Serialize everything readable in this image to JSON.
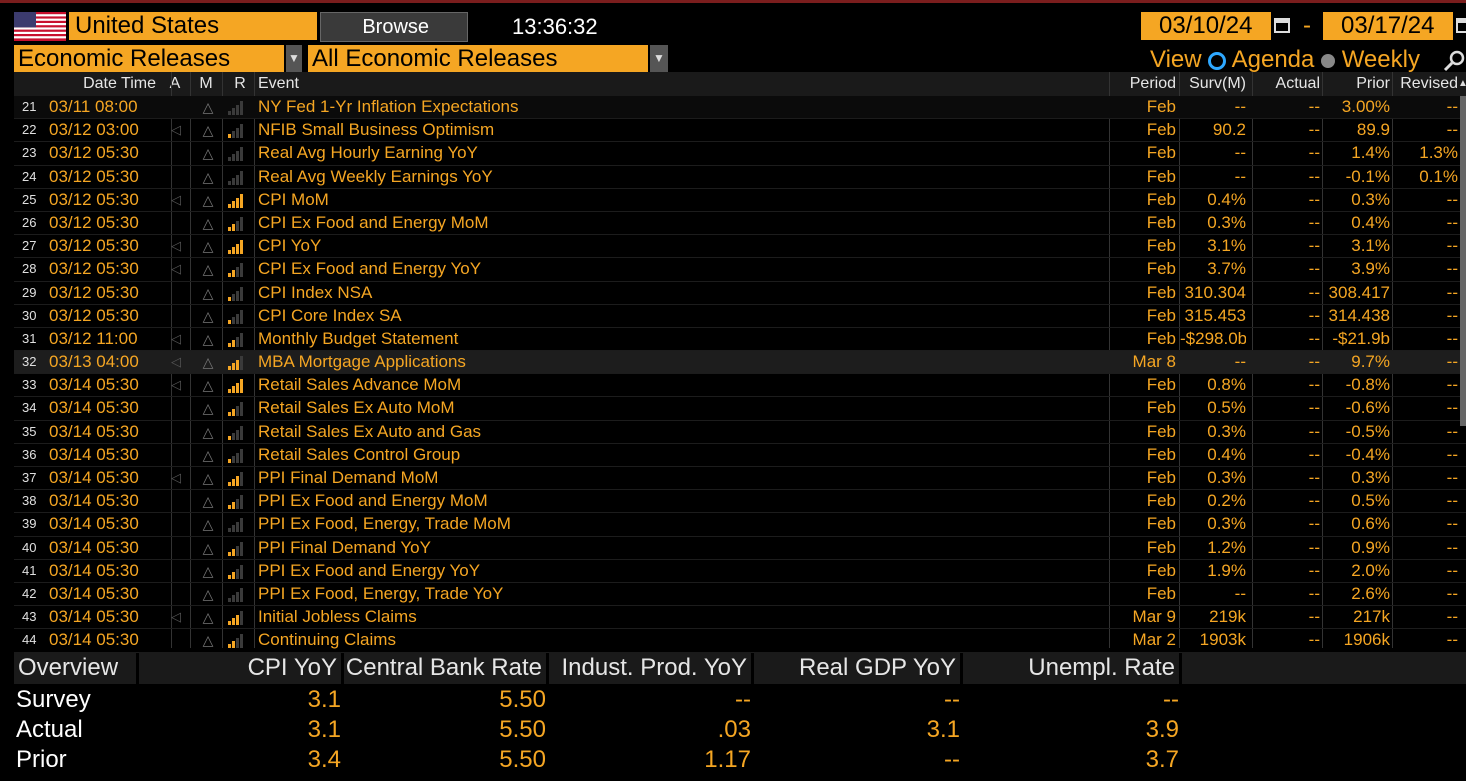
{
  "top": {
    "country": "United States",
    "browse_label": " Browse",
    "time": "13:36:32",
    "date_from": "03/10/24",
    "date_sep": "-",
    "date_to": "03/17/24",
    "category": "Economic Releases",
    "filter": "All Economic Releases",
    "view_label": "View",
    "view_agenda": "Agenda",
    "view_weekly": "Weekly"
  },
  "table": {
    "headers": {
      "datetime": "Date Time",
      "a": "A",
      "m": "M",
      "r": "R",
      "event": "Event",
      "period": "Period",
      "survey": "Surv(M)",
      "actual": "Actual",
      "prior": "Prior",
      "revised": "Revised"
    },
    "rows": [
      {
        "idx": "21",
        "dt": "03/11 08:00",
        "a": false,
        "r": 0,
        "event": "NY Fed 1-Yr Inflation Expectations",
        "period": "Feb",
        "surv": "--",
        "actual": "--",
        "prior": "3.00%",
        "revised": "--"
      },
      {
        "idx": "22",
        "dt": "03/12 03:00",
        "a": true,
        "r": 1,
        "event": "NFIB Small Business Optimism",
        "period": "Feb",
        "surv": "90.2",
        "actual": "--",
        "prior": "89.9",
        "revised": "--"
      },
      {
        "idx": "23",
        "dt": "03/12 05:30",
        "a": false,
        "r": 0,
        "event": "Real Avg Hourly Earning YoY",
        "period": "Feb",
        "surv": "--",
        "actual": "--",
        "prior": "1.4%",
        "revised": "1.3%"
      },
      {
        "idx": "24",
        "dt": "03/12 05:30",
        "a": false,
        "r": 0,
        "event": "Real Avg Weekly Earnings YoY",
        "period": "Feb",
        "surv": "--",
        "actual": "--",
        "prior": "-0.1%",
        "revised": "0.1%"
      },
      {
        "idx": "25",
        "dt": "03/12 05:30",
        "a": true,
        "r": 4,
        "event": "CPI MoM",
        "period": "Feb",
        "surv": "0.4%",
        "actual": "--",
        "prior": "0.3%",
        "revised": "--"
      },
      {
        "idx": "26",
        "dt": "03/12 05:30",
        "a": false,
        "r": 2,
        "event": "CPI Ex Food and Energy MoM",
        "period": "Feb",
        "surv": "0.3%",
        "actual": "--",
        "prior": "0.4%",
        "revised": "--"
      },
      {
        "idx": "27",
        "dt": "03/12 05:30",
        "a": true,
        "r": 4,
        "event": "CPI YoY",
        "period": "Feb",
        "surv": "3.1%",
        "actual": "--",
        "prior": "3.1%",
        "revised": "--"
      },
      {
        "idx": "28",
        "dt": "03/12 05:30",
        "a": true,
        "r": 2,
        "event": "CPI Ex Food and Energy YoY",
        "period": "Feb",
        "surv": "3.7%",
        "actual": "--",
        "prior": "3.9%",
        "revised": "--"
      },
      {
        "idx": "29",
        "dt": "03/12 05:30",
        "a": false,
        "r": 1,
        "event": "CPI Index NSA",
        "period": "Feb",
        "surv": "310.304",
        "actual": "--",
        "prior": "308.417",
        "revised": "--"
      },
      {
        "idx": "30",
        "dt": "03/12 05:30",
        "a": false,
        "r": 1,
        "event": "CPI Core Index SA",
        "period": "Feb",
        "surv": "315.453",
        "actual": "--",
        "prior": "314.438",
        "revised": "--"
      },
      {
        "idx": "31",
        "dt": "03/12 11:00",
        "a": true,
        "r": 2,
        "event": "Monthly Budget Statement",
        "period": "Feb",
        "surv": "-$298.0b",
        "actual": "--",
        "prior": "-$21.9b",
        "revised": "--"
      },
      {
        "idx": "32",
        "dt": "03/13 04:00",
        "a": true,
        "r": 3,
        "event": "MBA Mortgage Applications",
        "period": "Mar 8",
        "surv": "--",
        "actual": "--",
        "prior": "9.7%",
        "revised": "--",
        "hl": true
      },
      {
        "idx": "33",
        "dt": "03/14 05:30",
        "a": true,
        "r": 4,
        "event": "Retail Sales Advance MoM",
        "period": "Feb",
        "surv": "0.8%",
        "actual": "--",
        "prior": "-0.8%",
        "revised": "--"
      },
      {
        "idx": "34",
        "dt": "03/14 05:30",
        "a": false,
        "r": 2,
        "event": "Retail Sales Ex Auto MoM",
        "period": "Feb",
        "surv": "0.5%",
        "actual": "--",
        "prior": "-0.6%",
        "revised": "--"
      },
      {
        "idx": "35",
        "dt": "03/14 05:30",
        "a": false,
        "r": 1,
        "event": "Retail Sales Ex Auto and Gas",
        "period": "Feb",
        "surv": "0.3%",
        "actual": "--",
        "prior": "-0.5%",
        "revised": "--"
      },
      {
        "idx": "36",
        "dt": "03/14 05:30",
        "a": false,
        "r": 1,
        "event": "Retail Sales Control Group",
        "period": "Feb",
        "surv": "0.4%",
        "actual": "--",
        "prior": "-0.4%",
        "revised": "--"
      },
      {
        "idx": "37",
        "dt": "03/14 05:30",
        "a": true,
        "r": 3,
        "event": "PPI Final Demand MoM",
        "period": "Feb",
        "surv": "0.3%",
        "actual": "--",
        "prior": "0.3%",
        "revised": "--"
      },
      {
        "idx": "38",
        "dt": "03/14 05:30",
        "a": false,
        "r": 2,
        "event": "PPI Ex Food and Energy MoM",
        "period": "Feb",
        "surv": "0.2%",
        "actual": "--",
        "prior": "0.5%",
        "revised": "--"
      },
      {
        "idx": "39",
        "dt": "03/14 05:30",
        "a": false,
        "r": 0,
        "event": "PPI Ex Food, Energy, Trade MoM",
        "period": "Feb",
        "surv": "0.3%",
        "actual": "--",
        "prior": "0.6%",
        "revised": "--"
      },
      {
        "idx": "40",
        "dt": "03/14 05:30",
        "a": false,
        "r": 2,
        "event": "PPI Final Demand YoY",
        "period": "Feb",
        "surv": "1.2%",
        "actual": "--",
        "prior": "0.9%",
        "revised": "--"
      },
      {
        "idx": "41",
        "dt": "03/14 05:30",
        "a": false,
        "r": 2,
        "event": "PPI Ex Food and Energy YoY",
        "period": "Feb",
        "surv": "1.9%",
        "actual": "--",
        "prior": "2.0%",
        "revised": "--"
      },
      {
        "idx": "42",
        "dt": "03/14 05:30",
        "a": false,
        "r": 0,
        "event": "PPI Ex Food, Energy, Trade YoY",
        "period": "Feb",
        "surv": "--",
        "actual": "--",
        "prior": "2.6%",
        "revised": "--"
      },
      {
        "idx": "43",
        "dt": "03/14 05:30",
        "a": true,
        "r": 3,
        "event": "Initial Jobless Claims",
        "period": "Mar 9",
        "surv": "219k",
        "actual": "--",
        "prior": "217k",
        "revised": "--"
      },
      {
        "idx": "44",
        "dt": "03/14 05:30",
        "a": false,
        "r": 2,
        "event": "Continuing Claims",
        "period": "Mar 2",
        "surv": "1903k",
        "actual": "--",
        "prior": "1906k",
        "revised": "--"
      }
    ]
  },
  "overview": {
    "title": "Overview",
    "columns": [
      "CPI YoY",
      "Central Bank Rate",
      "Indust. Prod. YoY",
      "Real GDP YoY",
      "Unempl. Rate"
    ],
    "rows": [
      {
        "label": "Survey",
        "values": [
          "3.1",
          "5.50",
          "--",
          "--",
          "--"
        ]
      },
      {
        "label": "Actual",
        "values": [
          "3.1",
          "5.50",
          ".03",
          "3.1",
          "3.9"
        ]
      },
      {
        "label": "Prior",
        "values": [
          "3.4",
          "5.50",
          "1.17",
          "--",
          "3.7"
        ]
      }
    ]
  },
  "colors": {
    "accent": "#f5a623",
    "background": "#000000",
    "radio_on": "#2ea8ff"
  }
}
